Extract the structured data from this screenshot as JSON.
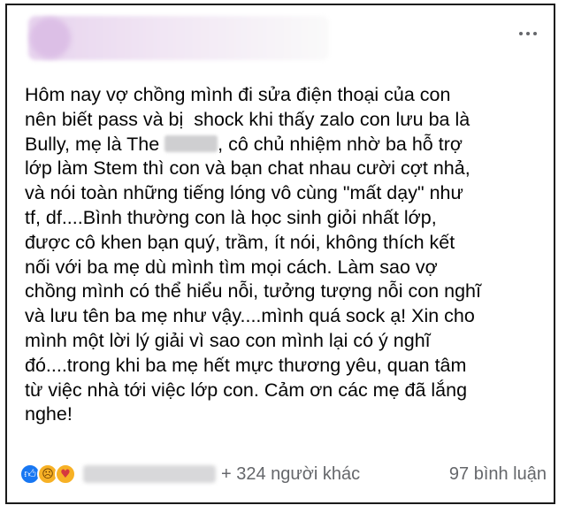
{
  "post": {
    "text_lines": [
      "Hôm nay vợ chồng mình đi sửa điện thoại của con",
      "nên biết pass và bị  shock khi thấy zalo con lưu ba là",
      "Bully, mẹ là The",
      ", cô chủ nhiệm nhờ ba hỗ trợ",
      "lớp làm Stem thì con và bạn chat nhau cười cợt nhả,",
      "và nói toàn những tiếng lóng vô cùng \"mất dạy\" như",
      "tf, df....Bình thường con là học sinh giỏi nhất lớp,",
      "được cô khen bạn quý, trầm, ít nói, không thích kết",
      "nối với ba mẹ dù mình tìm mọi cách. Làm sao vợ",
      "chồng mình có thể hiểu nỗi, tưởng tượng nỗi con nghĩ",
      "và lưu tên ba mẹ như vậy....mình quá sock ạ! Xin cho",
      "mình một lời lý giải vì sao con mình lại có ý nghĩ",
      "đó....trong khi ba mẹ hết mực thương yêu, quan tâm",
      "từ việc nhà tới việc lớp con. Cảm ơn các mẹ đã lắng",
      "nghe!"
    ]
  },
  "footer": {
    "others_text": "+ 324 người khác",
    "comments_text": "97 bình luận",
    "reactions": [
      "like",
      "sad",
      "care"
    ]
  },
  "icons": {
    "more": "more-horizontal-icon"
  }
}
